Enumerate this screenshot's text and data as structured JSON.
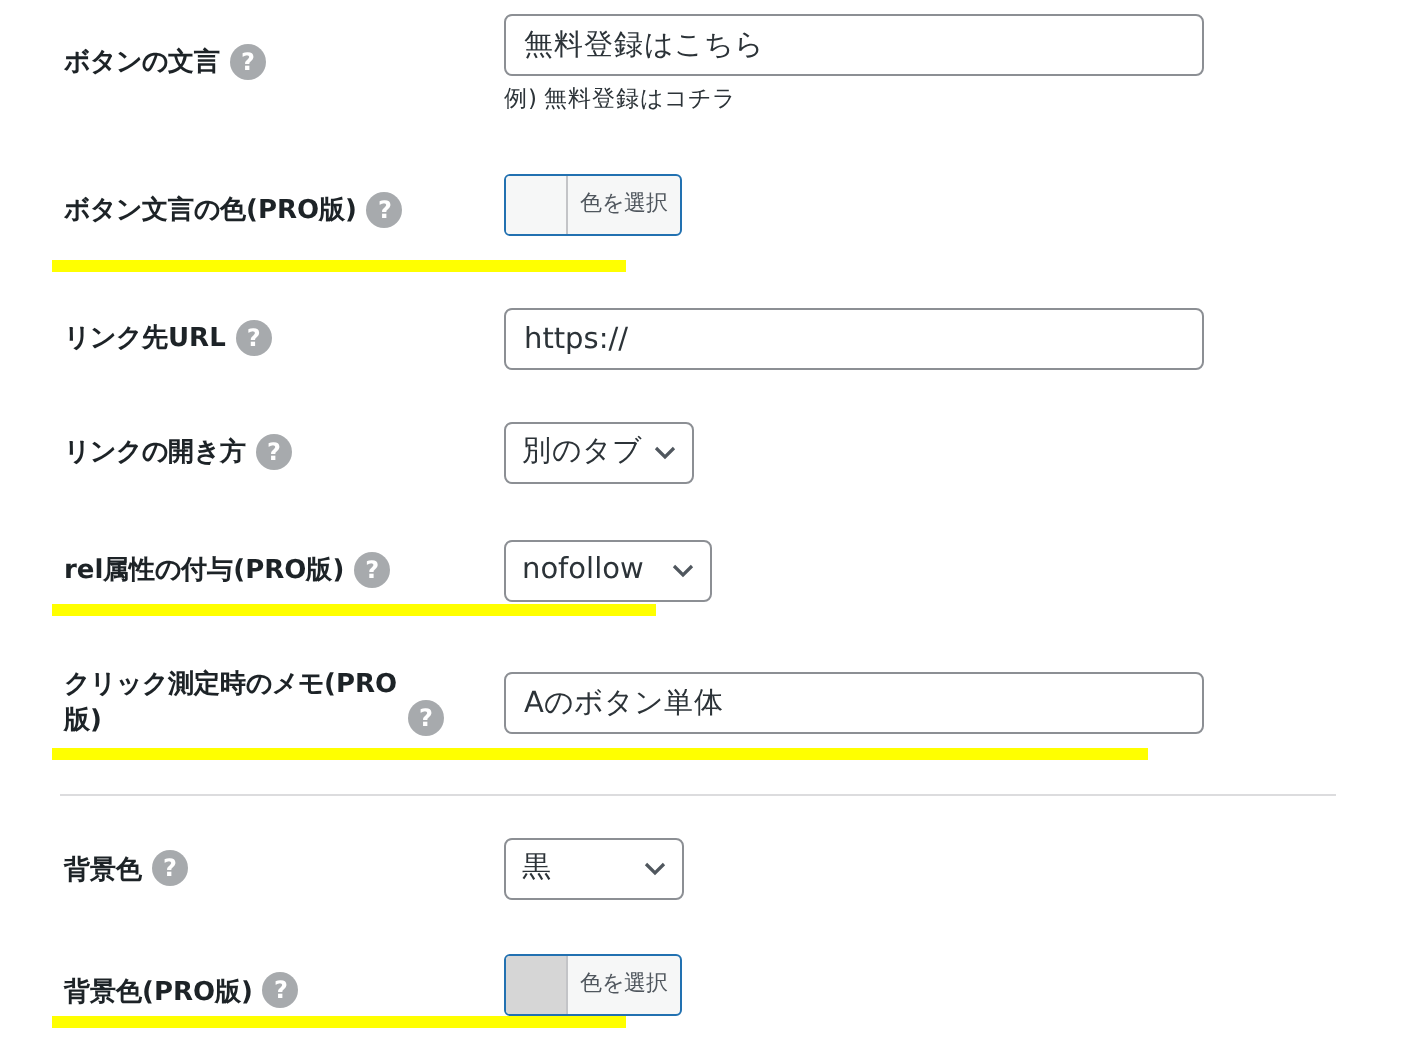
{
  "fields": [
    {
      "kind": "text",
      "label": "ボタンの文言",
      "help": "?",
      "value": "無料登録はこちら",
      "hint": "例) 無料登録はコチラ",
      "highlighted": false
    },
    {
      "kind": "color",
      "label": "ボタン文言の色(PRO版)",
      "help": "?",
      "button": "色を選択",
      "color": "#f6f7f7",
      "highlighted": true
    },
    {
      "kind": "text",
      "label": "リンク先URL",
      "help": "?",
      "value": "https://",
      "highlighted": false
    },
    {
      "kind": "select",
      "label": "リンクの開き方",
      "help": "?",
      "value": "別のタブ",
      "highlighted": false
    },
    {
      "kind": "select",
      "label": "rel属性の付与(PRO版)",
      "help": "?",
      "value": "nofollow",
      "highlighted": true
    },
    {
      "kind": "text",
      "label": "クリック測定時のメモ(PRO版)",
      "help": "?",
      "value": "Aのボタン単体",
      "highlighted": true
    },
    {
      "kind": "divider"
    },
    {
      "kind": "select",
      "label": "背景色",
      "help": "?",
      "value": "黒",
      "highlighted": false
    },
    {
      "kind": "color",
      "label": "背景色(PRO版)",
      "help": "?",
      "button": "色を選択",
      "color": "#d6d6d6",
      "highlighted": true
    }
  ]
}
